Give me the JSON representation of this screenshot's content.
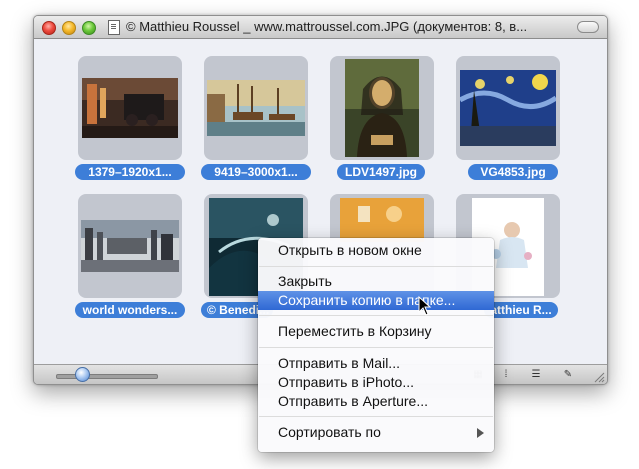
{
  "window": {
    "title": "©  Matthieu Roussel _  www.mattroussel.com.JPG (документов: 8, в..."
  },
  "thumbnails": [
    {
      "label": "1379–1920x1..."
    },
    {
      "label": "9419–3000x1..."
    },
    {
      "label": "LDV1497.jpg"
    },
    {
      "label": "VG4853.jpg"
    },
    {
      "label": "world wonders..."
    },
    {
      "label": "©  Benedi..."
    },
    {
      "label": ""
    },
    {
      "label": "atthieu R..."
    }
  ],
  "context_menu": {
    "items": [
      {
        "label": "Открыть в новом окне"
      },
      {
        "label": "Закрыть"
      },
      {
        "label": "Сохранить копию в папке..."
      },
      {
        "label": "Переместить в Корзину"
      },
      {
        "label": "Отправить в Mail..."
      },
      {
        "label": "Отправить в iPhoto..."
      },
      {
        "label": "Отправить в Aperture..."
      },
      {
        "label": "Сортировать по"
      }
    ],
    "selected_index": 2
  },
  "statusbar": {
    "zoom_level": 0.25
  },
  "colors": {
    "selection_blue": "#3d7ed8",
    "menu_highlight": "#2f68d4"
  }
}
